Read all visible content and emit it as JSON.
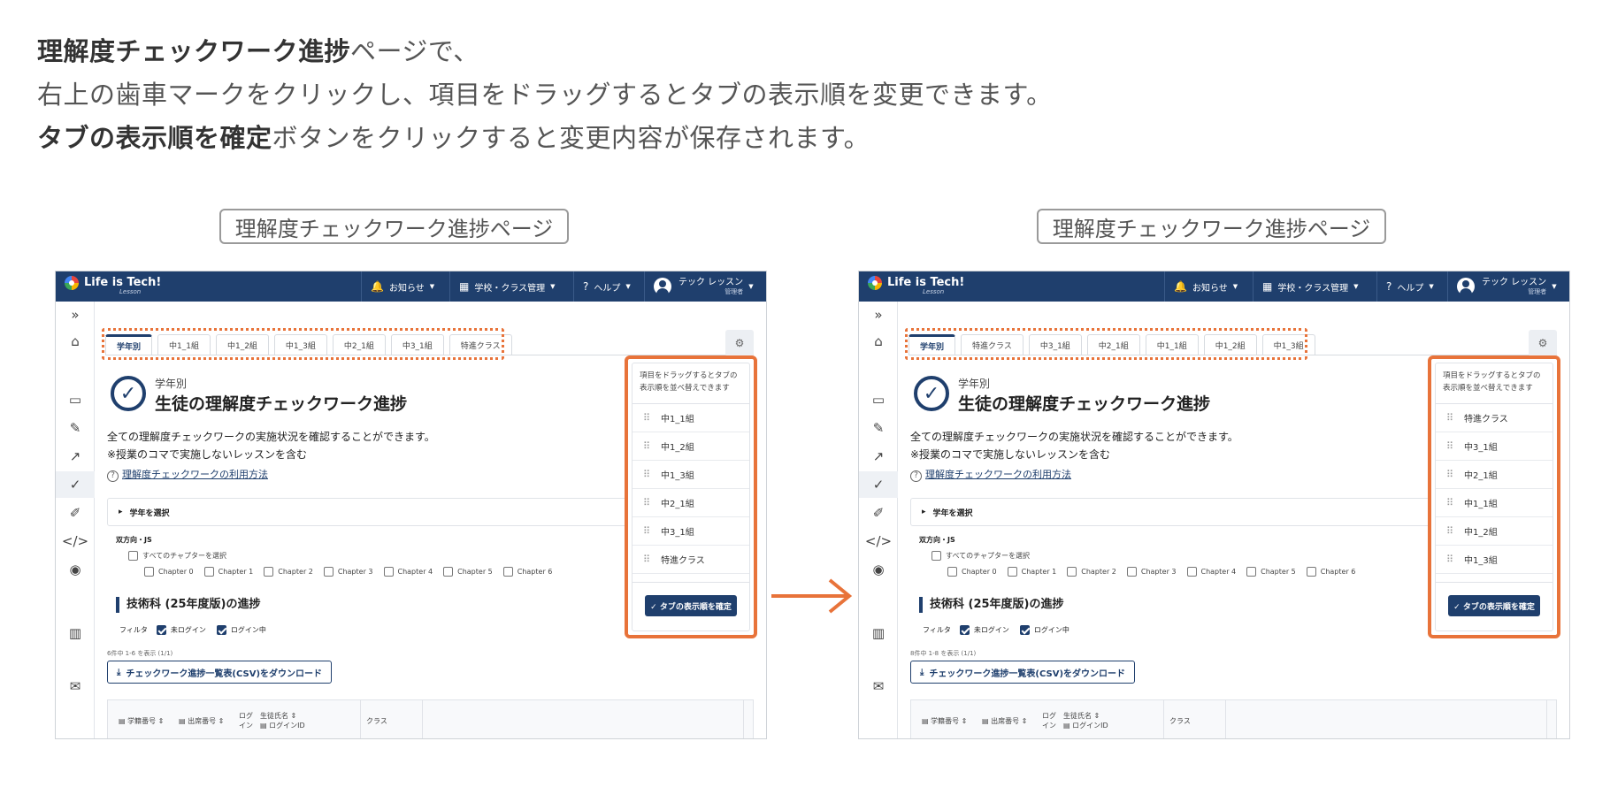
{
  "intro": {
    "line1_bold": "理解度チェックワーク進捗",
    "line1_rest": "ページで、",
    "line2": "右上の歯車マークをクリックし、項目をドラッグするとタブの表示順を変更できます。",
    "line3_bold": "タブの表示順を確定",
    "line3_rest": "ボタンをクリックすると変更内容が保存されます。"
  },
  "panels": [
    {
      "label": "理解度チェックワーク進捗ページ"
    },
    {
      "label": "理解度チェックワーク進捗ページ"
    }
  ],
  "app": {
    "logo": "Life is Tech!",
    "logo_sub": "Lesson",
    "nav": {
      "notice": "お知らせ",
      "school": "学校・クラス管理",
      "help": "ヘルプ"
    },
    "user": {
      "name": "テック レッスン",
      "role": "管理者"
    },
    "grade_label": "学年別",
    "page_title": "生徒の理解度チェックワーク進捗",
    "desc1": "全ての理解度チェックワークの実施状況を確認することができます。",
    "desc2": "※授業のコマで実施しないレッスンを含む",
    "howto": "理解度チェックワークの利用方法",
    "select_grade": "学年を選択",
    "course": "双方向・JS",
    "all_chapters": "すべてのチャプターを選択",
    "chapters": [
      "Chapter 0",
      "Chapter 1",
      "Chapter 2",
      "Chapter 3",
      "Chapter 4",
      "Chapter 5",
      "Chapter 6"
    ],
    "section_title": "技術科 (25年度版)の進捗",
    "filter_label": "フィルタ",
    "filter_not_logged": "未ログイン",
    "filter_logged": "ログイン中",
    "download": "チェックワーク進捗一覧表(CSV)をダウンロード",
    "table_headers": {
      "student_no": "学籍番号 ⇕",
      "seat_no": "出席番号 ⇕",
      "login": "ログ\nイン",
      "name": "生徒氏名 ⇕",
      "login_id": "ログインID",
      "class": "クラス"
    },
    "popup_note": "項目をドラッグするとタブの表示順を並べ替えできます",
    "confirm_button": "✓ タブの表示順を確定"
  },
  "before": {
    "count": "6件中 1-6 を表示 (1/1)",
    "tabs": [
      "学年別",
      "中1_1組",
      "中1_2組",
      "中1_3組",
      "中2_1組",
      "中3_1組",
      "特進クラス"
    ],
    "order": [
      "中1_1組",
      "中1_2組",
      "中1_3組",
      "中2_1組",
      "中3_1組",
      "特進クラス"
    ]
  },
  "after": {
    "count": "8件中 1-8 を表示 (1/1)",
    "tabs": [
      "学年別",
      "特進クラス",
      "中3_1組",
      "中2_1組",
      "中1_1組",
      "中1_2組",
      "中1_3組"
    ],
    "order": [
      "特進クラス",
      "中3_1組",
      "中2_1組",
      "中1_1組",
      "中1_2組",
      "中1_3組"
    ]
  },
  "colors": {
    "navy": "#1f3f6d",
    "accent": "#e8733a"
  }
}
